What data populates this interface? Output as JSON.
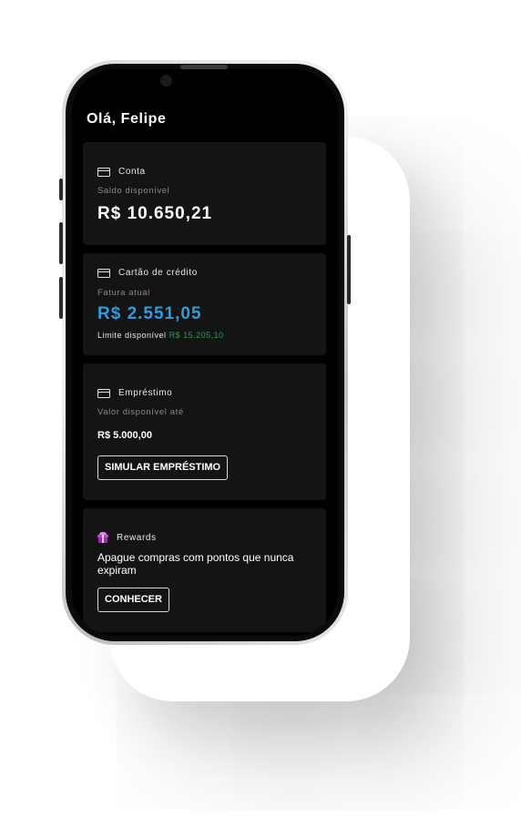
{
  "greeting": "Olá, Felipe",
  "account": {
    "title": "Conta",
    "label": "Saldo disponível",
    "balance": "R$ 10.650,21"
  },
  "credit_card": {
    "title": "Cartão de crédito",
    "label": "Fatura atual",
    "invoice": "R$ 2.551,05",
    "limit_label": "Limite disponível",
    "limit_value": "R$ 15.205,10"
  },
  "loan": {
    "title": "Empréstimo",
    "label": "Valor disponível até",
    "amount": "R$ 5.000,00",
    "button_label": "SIMULAR EMPRÉSTIMO"
  },
  "rewards": {
    "title": "Rewards",
    "description": "Apague compras com pontos que nunca expiram",
    "button_label": "CONHECER"
  },
  "colors": {
    "invoice_blue": "#2f9be0",
    "limit_green": "#2e9d52",
    "gift_purple": "#9c27b0"
  },
  "icons": {
    "account": "credit-card-icon",
    "credit_card": "credit-card-icon",
    "loan": "credit-card-icon",
    "rewards": "gift-icon"
  }
}
